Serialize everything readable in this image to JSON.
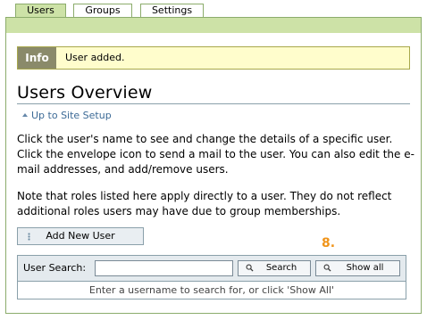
{
  "tabs": [
    {
      "label": "Users",
      "active": true
    },
    {
      "label": "Groups",
      "active": false
    },
    {
      "label": "Settings",
      "active": false
    }
  ],
  "info": {
    "label": "Info",
    "message": "User added."
  },
  "page_title": "Users Overview",
  "up_link": "Up to Site Setup",
  "description": {
    "paragraph1": "Click the user's name to see and change the details of a specific user. Click the envelope icon to send a mail to the user. You can also edit the e-mail addresses, and add/remove users.",
    "paragraph2": "Note that roles listed here apply directly to a user. They do not reflect additional roles users may have due to group memberships."
  },
  "add_user_button": "Add New User",
  "step_number": "8.",
  "search": {
    "label": "User Search:",
    "value": "",
    "search_button": "Search",
    "show_all_button": "Show all",
    "hint": "Enter a username to search for, or click 'Show All'"
  },
  "colors": {
    "tab_active": "#cde2a7",
    "border_green": "#8cac6c",
    "info_bg": "#fffdcc",
    "info_label_bg": "#8a8a6a",
    "link": "#3c6a96",
    "step_orange": "#f0941a"
  }
}
